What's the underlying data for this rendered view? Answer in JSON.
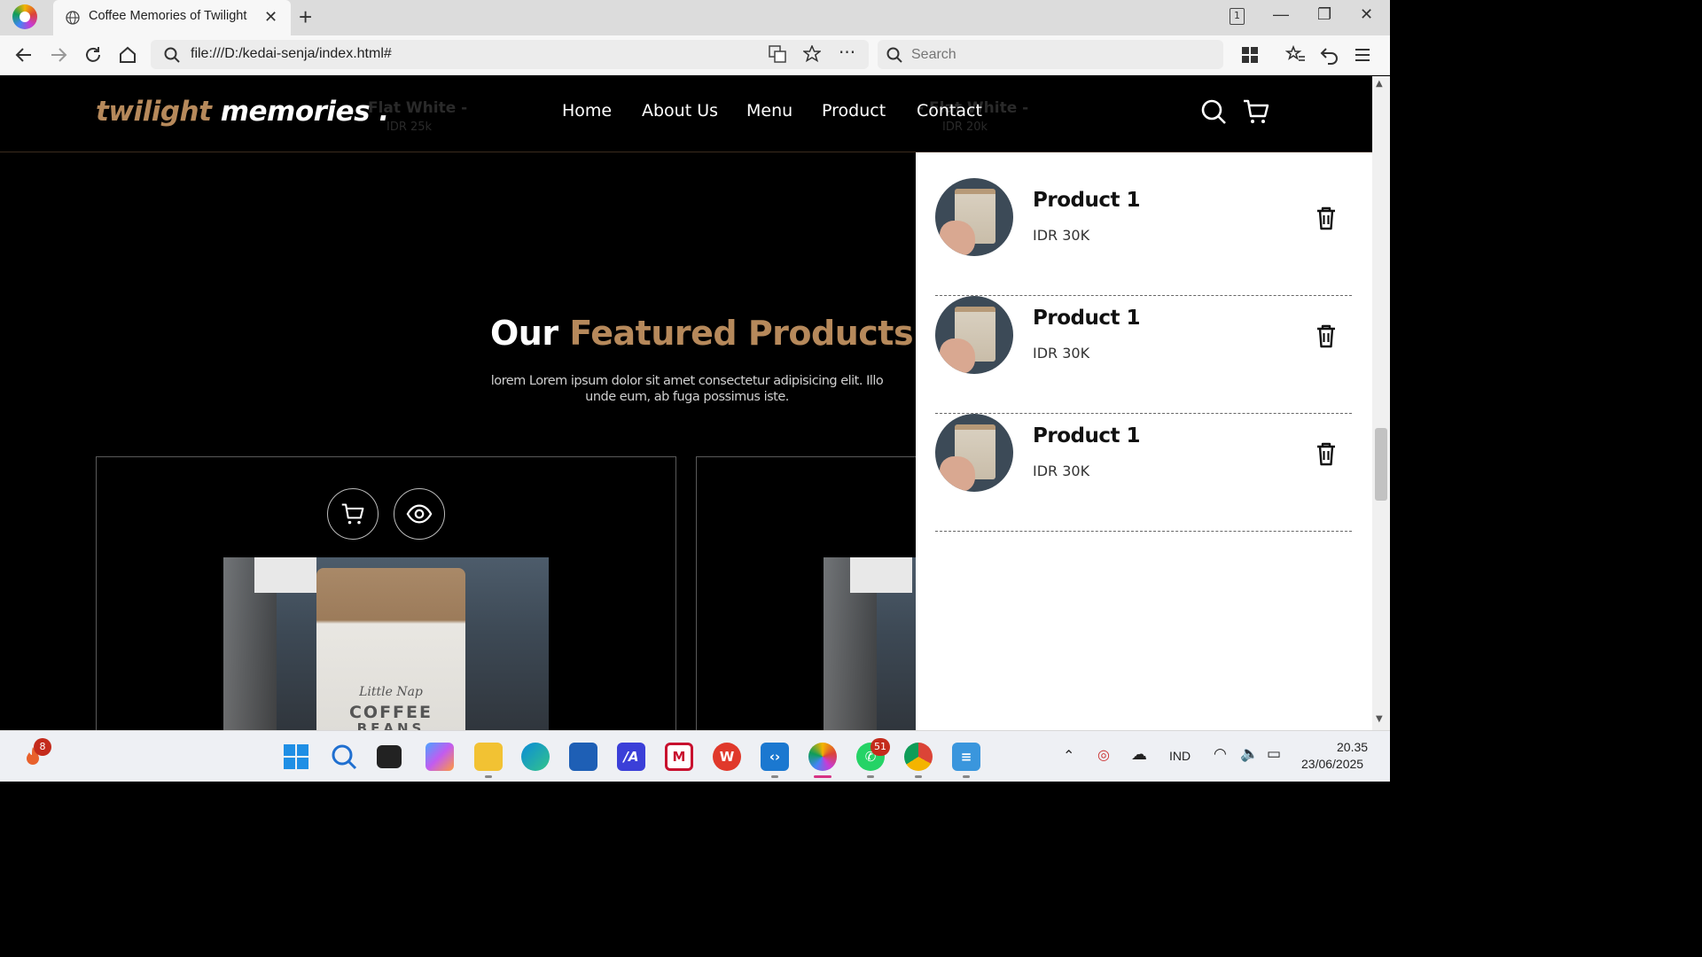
{
  "browser": {
    "tab_title": "Coffee Memories of Twilight",
    "tab_count": "1",
    "url": "file:///D:/kedai-senja/index.html#",
    "search_placeholder": "Search"
  },
  "site": {
    "logo_part1": "twilight",
    "logo_part2": " memories .",
    "ghost_menu": [
      {
        "name": "- Flat White -",
        "price": "IDR 25k"
      },
      {
        "name": "- Flat White -",
        "price": "IDR 20k"
      }
    ],
    "nav": [
      "Home",
      "About Us",
      "Menu",
      "Product",
      "Contact"
    ],
    "featured_title_1": "Our ",
    "featured_title_2": "Featured Products",
    "featured_desc": "lorem Lorem ipsum dolor sit amet consectetur adipisicing elit. Illo unde eum, ab fuga possimus iste.",
    "bag_brand": "Little Nap",
    "bag_line1": "COFFEE",
    "bag_line2": "BEANS"
  },
  "cart": {
    "items": [
      {
        "name": "Product 1",
        "price": "IDR 30K"
      },
      {
        "name": "Product 1",
        "price": "IDR 30K"
      },
      {
        "name": "Product 1",
        "price": "IDR 30K"
      }
    ]
  },
  "taskbar": {
    "notification_badge": "8",
    "whatsapp_badge": "51",
    "language": "IND",
    "time": "20.35",
    "date": "23/06/2025"
  },
  "colors": {
    "accent": "#b6895b",
    "page_bg": "#000000",
    "cart_bg": "#ffffff"
  }
}
